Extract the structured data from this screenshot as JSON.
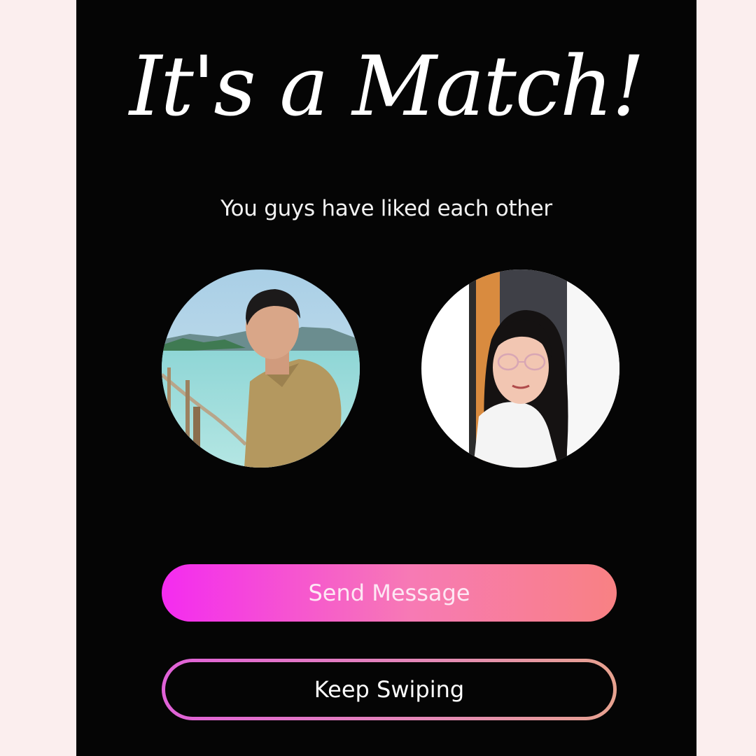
{
  "match": {
    "title": "It's a Match!",
    "subtitle": "You guys have liked each other"
  },
  "profiles": {
    "left_avatar_icon": "man-photo",
    "right_avatar_icon": "woman-photo"
  },
  "actions": {
    "send_message_label": "Send Message",
    "keep_swiping_label": "Keep Swiping"
  },
  "colors": {
    "background": "#050505",
    "page_margin": "#fbeeee",
    "primary_gradient_start": "#f42bf0",
    "primary_gradient_end": "#f88183",
    "outline_gradient_start": "#e061d8",
    "outline_gradient_end": "#e7a28f"
  }
}
